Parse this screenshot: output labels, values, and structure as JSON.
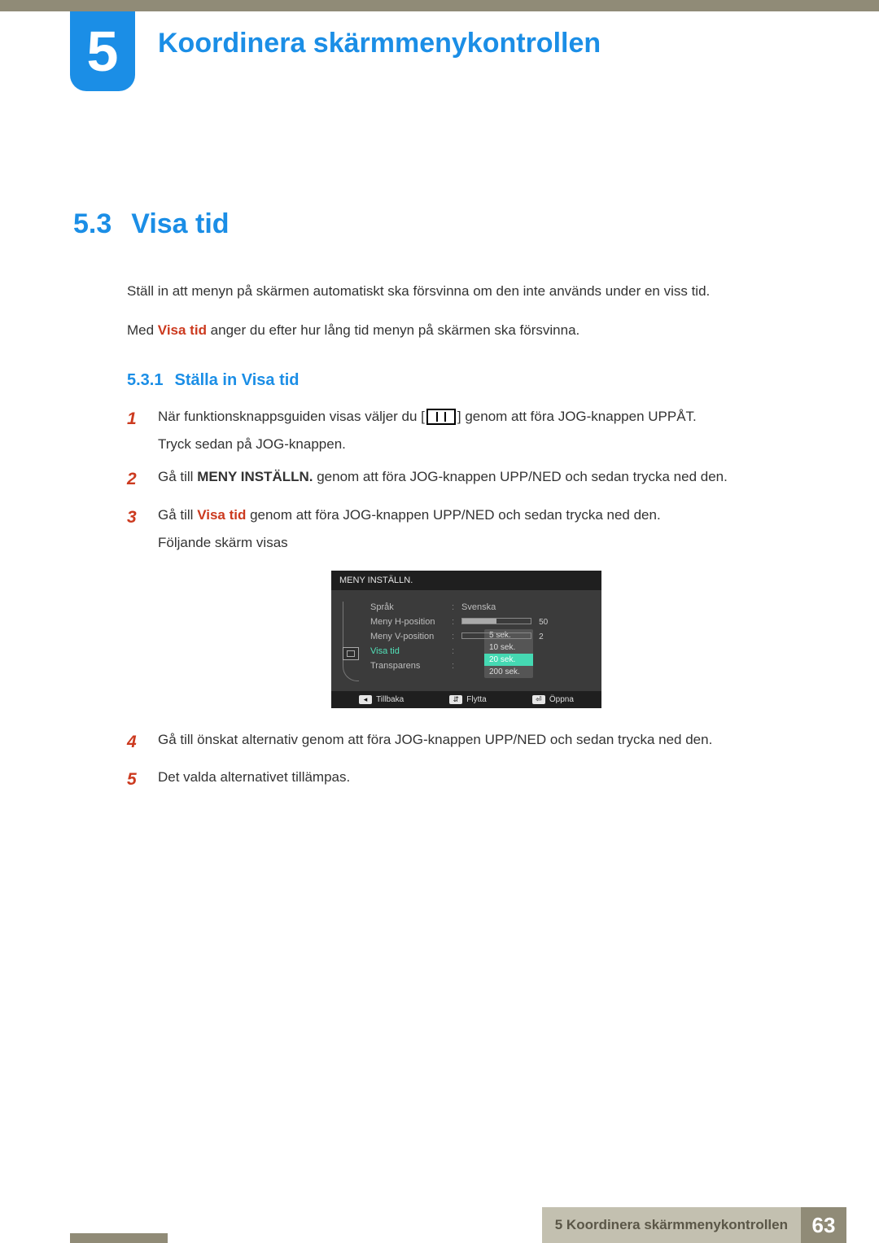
{
  "chapter": {
    "number": "5",
    "title": "Koordinera skärmmenykontrollen"
  },
  "section": {
    "number": "5.3",
    "title": "Visa tid",
    "intro1": "Ställ in att menyn på skärmen automatiskt ska försvinna om den inte används under en viss tid.",
    "intro2_pre": "Med ",
    "intro2_term": "Visa tid",
    "intro2_post": " anger du efter hur lång tid menyn på skärmen ska försvinna."
  },
  "subsection": {
    "number": "5.3.1",
    "title": "Ställa in Visa tid"
  },
  "steps": {
    "s1": {
      "n": "1",
      "a": "När funktionsknappsguiden visas väljer du [",
      "b": "] genom att föra JOG-knappen UPPÅT.",
      "c": "Tryck sedan på JOG-knappen."
    },
    "s2": {
      "n": "2",
      "pre": "Gå till ",
      "bold": "MENY INSTÄLLN.",
      "post": " genom att föra JOG-knappen UPP/NED och sedan trycka ned den."
    },
    "s3": {
      "n": "3",
      "pre": "Gå till ",
      "term": "Visa tid",
      "post": " genom att föra JOG-knappen UPP/NED och sedan trycka ned den.",
      "line2": "Följande skärm visas"
    },
    "s4": {
      "n": "4",
      "text": "Gå till önskat alternativ genom att föra JOG-knappen UPP/NED och sedan trycka ned den."
    },
    "s5": {
      "n": "5",
      "text": "Det valda alternativet tillämpas."
    }
  },
  "osd": {
    "title": "MENY INSTÄLLN.",
    "rows": {
      "lang_lbl": "Språk",
      "lang_val": "Svenska",
      "hpos_lbl": "Meny H-position",
      "hpos_val": "50",
      "vpos_lbl": "Meny V-position",
      "vpos_val": "2",
      "visa_lbl": "Visa tid",
      "trans_lbl": "Transparens"
    },
    "options": {
      "o1": "5 sek.",
      "o2": "10 sek.",
      "o3": "20 sek.",
      "o4": "200 sek."
    },
    "footer": {
      "back": "Tillbaka",
      "move": "Flytta",
      "open": "Öppna"
    }
  },
  "footer": {
    "text": "5 Koordinera skärmmenykontrollen",
    "page": "63"
  }
}
